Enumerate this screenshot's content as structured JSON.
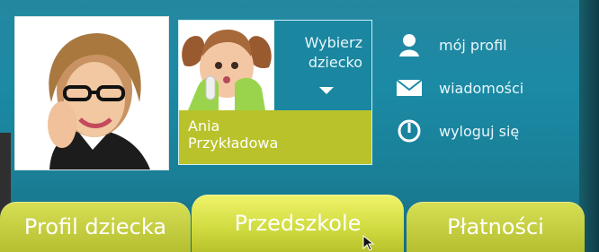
{
  "child_selector": {
    "prompt_line1": "Wybierz",
    "prompt_line2": "dziecko",
    "name_line1": "Ania",
    "name_line2": "Przykładowa"
  },
  "menu": {
    "items": [
      {
        "label": "mój profil",
        "icon": "user-icon"
      },
      {
        "label": "wiadomości",
        "icon": "envelope-icon"
      },
      {
        "label": "wyloguj się",
        "icon": "power-icon"
      }
    ]
  },
  "tabs": [
    {
      "label": "Profil dziecka",
      "active": false
    },
    {
      "label": "Przedszkole",
      "active": true
    },
    {
      "label": "Płatności",
      "active": false
    }
  ],
  "colors": {
    "background": "#1b8aa5",
    "tab": "#c9d13c",
    "child_name_bar": "#b9c22a"
  }
}
